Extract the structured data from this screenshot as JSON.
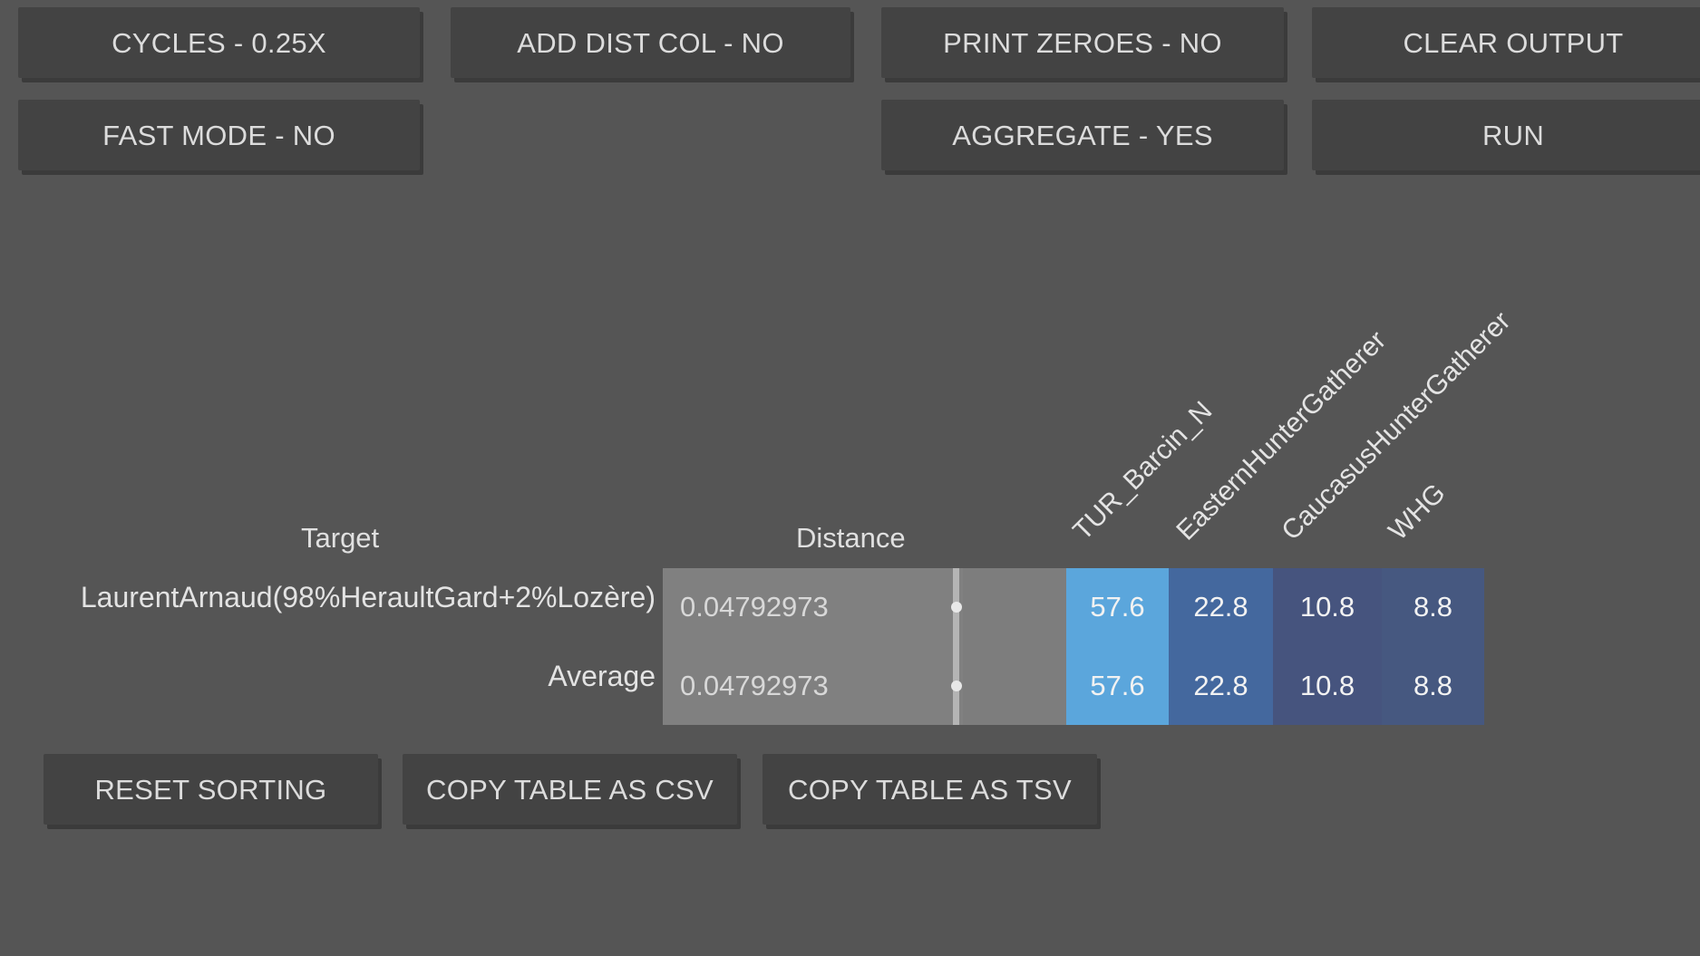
{
  "toolbar": {
    "row1": [
      {
        "label": "CYCLES - 0.25X",
        "name": "cycles-button"
      },
      {
        "label": "ADD DIST COL - NO",
        "name": "add-dist-col-button"
      },
      {
        "label": "PRINT ZEROES - NO",
        "name": "print-zeroes-button"
      },
      {
        "label": "CLEAR OUTPUT",
        "name": "clear-output-button"
      }
    ],
    "row2": [
      {
        "label": "FAST MODE - NO",
        "name": "fast-mode-button"
      },
      {
        "label": "AGGREGATE - YES",
        "name": "aggregate-button"
      },
      {
        "label": "RUN",
        "name": "run-button"
      }
    ]
  },
  "table": {
    "header_target": "Target",
    "header_distance": "Distance",
    "component_columns": [
      "TUR_Barcin_N",
      "EasternHunterGatherer",
      "CaucasusHunterGatherer",
      "WHG"
    ],
    "rows": [
      {
        "target": "LaurentArnaud(98%HeraultGard+2%Lozère)",
        "distance": "0.04792973",
        "values": [
          "57.6",
          "22.8",
          "10.8",
          "8.8"
        ]
      },
      {
        "target": "Average",
        "distance": "0.04792973",
        "values": [
          "57.6",
          "22.8",
          "10.8",
          "8.8"
        ]
      }
    ],
    "colors": {
      "background": "#555555",
      "table_cell_gray": "#808080",
      "column_1": "#5BA6DC",
      "column_2": "#44689E",
      "column_3": "#46547E",
      "column_4": "#465880",
      "bar_line": "#b4b4b4",
      "bar_dot": "#e8e8e8"
    }
  },
  "footer": {
    "buttons": [
      {
        "label": "RESET SORTING",
        "name": "reset-sorting-button"
      },
      {
        "label": "COPY TABLE AS CSV",
        "name": "copy-csv-button"
      },
      {
        "label": "COPY TABLE AS TSV",
        "name": "copy-tsv-button"
      }
    ]
  },
  "chart_data": {
    "type": "table",
    "title": "",
    "categories": [
      "TUR_Barcin_N",
      "EasternHunterGatherer",
      "CaucasusHunterGatherer",
      "WHG"
    ],
    "series": [
      {
        "name": "LaurentArnaud(98%HeraultGard+2%Lozère)",
        "values": [
          57.6,
          22.8,
          10.8,
          8.8
        ],
        "distance": 0.04792973
      },
      {
        "name": "Average",
        "values": [
          57.6,
          22.8,
          10.8,
          8.8
        ],
        "distance": 0.04792973
      }
    ],
    "xlabel": "",
    "ylabel": "",
    "ylim": [
      0,
      100
    ],
    "legend": "none",
    "grid": false
  }
}
